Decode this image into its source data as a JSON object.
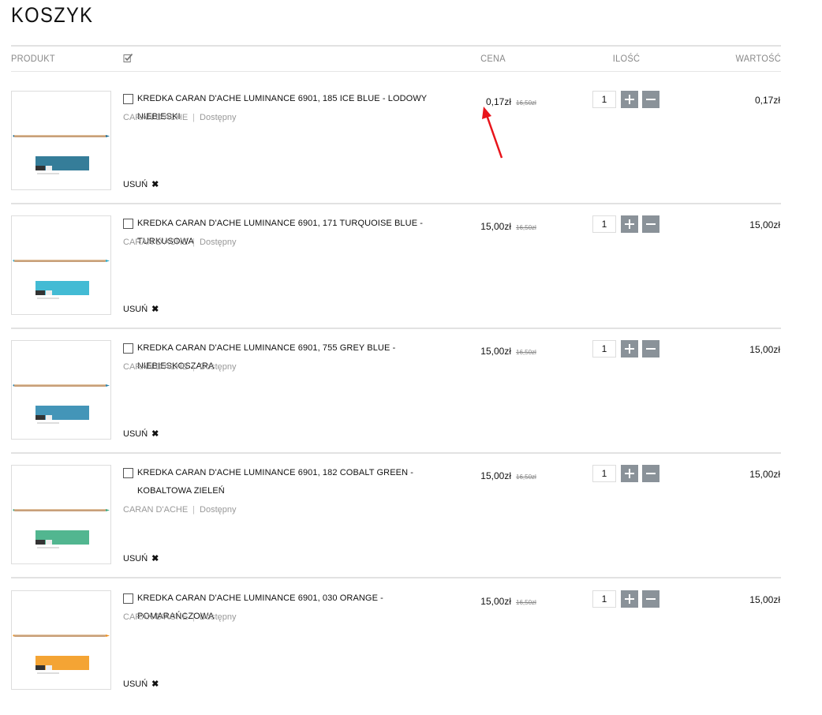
{
  "page": {
    "title": "KOSZYK"
  },
  "columns": {
    "product": "PRODUKT",
    "price": "CENA",
    "quantity": "ILOŚĆ",
    "value": "WARTOŚĆ"
  },
  "items": [
    {
      "name": "KREDKA CARAN D'ACHE LUMINANCE 6901, 185 ICE BLUE - LODOWY NIEBIESKI",
      "brand": "CARAN D'ACHE",
      "availability": "Dostępny",
      "price": "0,17zł",
      "old_price": "16,50zł",
      "quantity": "1",
      "total": "0,17zł",
      "remove_label": "USUŃ",
      "swatch_color": "#1f6f8e",
      "tip_color": "#1b6a8f"
    },
    {
      "name": "KREDKA CARAN D'ACHE LUMINANCE 6901, 171 TURQUOISE BLUE - TURKUSOWA",
      "brand": "CARAN D'ACHE",
      "availability": "Dostępny",
      "price": "15,00zł",
      "old_price": "16,50zł",
      "quantity": "1",
      "total": "15,00zł",
      "remove_label": "USUŃ",
      "swatch_color": "#2fb4cf",
      "tip_color": "#2aa8c7"
    },
    {
      "name": "KREDKA CARAN D'ACHE LUMINANCE 6901, 755 GREY BLUE - NIEBIESKOSZARA",
      "brand": "CARAN D'ACHE",
      "availability": "Dostępny",
      "price": "15,00zł",
      "old_price": "16,50zł",
      "quantity": "1",
      "total": "15,00zł",
      "remove_label": "USUŃ",
      "swatch_color": "#2f8ab0",
      "tip_color": "#2b82aa"
    },
    {
      "name": "KREDKA CARAN D'ACHE LUMINANCE 6901, 182 COBALT GREEN - KOBALTOWA ZIELEŃ",
      "brand": "CARAN D'ACHE",
      "availability": "Dostępny",
      "price": "15,00zł",
      "old_price": "16,50zł",
      "quantity": "1",
      "total": "15,00zł",
      "remove_label": "USUŃ",
      "swatch_color": "#3fae84",
      "tip_color": "#3aa57d"
    },
    {
      "name": "KREDKA CARAN D'ACHE LUMINANCE 6901, 030 ORANGE - POMARAŃCZOWA",
      "brand": "CARAN D'ACHE",
      "availability": "Dostępny",
      "price": "15,00zł",
      "old_price": "16,50zł",
      "quantity": "1",
      "total": "15,00zł",
      "remove_label": "USUŃ",
      "swatch_color": "#f39a1e",
      "tip_color": "#f08f1a"
    }
  ],
  "colors": {
    "annotation_arrow": "#e8141b",
    "qty_button": "#8a9299"
  }
}
